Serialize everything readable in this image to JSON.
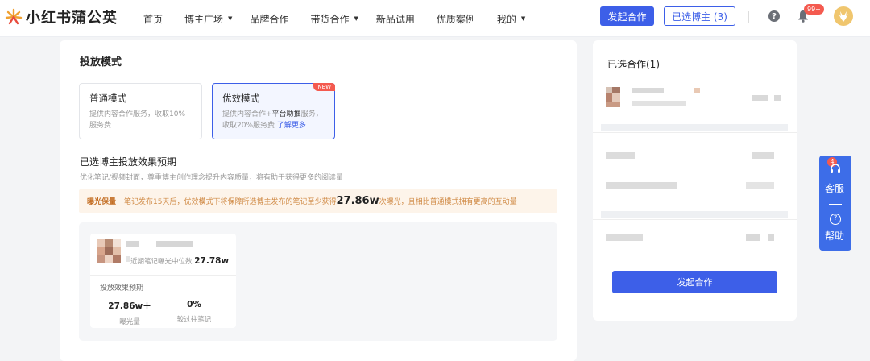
{
  "brand": {
    "name": "小红书蒲公英"
  },
  "nav": {
    "items": [
      {
        "label": "首页"
      },
      {
        "label": "博主广场"
      },
      {
        "label": "品牌合作"
      },
      {
        "label": "带货合作"
      },
      {
        "label": "新品试用"
      },
      {
        "label": "优质案例"
      },
      {
        "label": "我的"
      }
    ],
    "primary_btn": "发起合作",
    "selected_btn": "已选博主 (3)",
    "help_icon": "question-circle-icon",
    "bell_icon": "bell-icon",
    "bell_badge": "99+",
    "help_char": "?"
  },
  "main": {
    "section_title": "投放模式",
    "modes": [
      {
        "title": "普通模式",
        "desc": "提供内容合作服务，收取10%服务费"
      },
      {
        "title": "优效模式",
        "desc_a": "提供内容合作+",
        "desc_bold": "平台助推",
        "desc_b": "服务，收取20%服务费",
        "link": "了解更多",
        "tag": "NEW"
      }
    ],
    "expect_title": "已选博主投放效果预期",
    "expect_sub": "优化笔记/视频封面，尊重博主创作理念提升内容质量，将有助于获得更多的阅读量",
    "exposure": {
      "label": "曝光保量",
      "text_a": "笔记发布15天后，优效模式下将保障所选博主发布的笔记至少获得",
      "number": "27.86w",
      "text_b": "次曝光，且相比普通模式拥有更高的互动量"
    },
    "card": {
      "median_label": "近期笔记曝光中位数",
      "median_value": "27.78w",
      "predict_title": "投放效果预期",
      "stats": [
        {
          "value": "27.86w＋",
          "label": "曝光量"
        },
        {
          "value": "0%",
          "label": "较过往笔记"
        }
      ]
    }
  },
  "side": {
    "title": "已选合作(1)",
    "submit": "发起合作"
  },
  "float": {
    "count": "4",
    "service": "客服",
    "help": "帮助",
    "service_icon": "headset-icon",
    "help_icon": "question-circle-icon",
    "help_char": "?"
  },
  "colors": {
    "accent": "#3d5fe8",
    "badge": "#f45a4f",
    "warn_bg": "#fdf4ea",
    "warn_text": "#d08a45"
  }
}
